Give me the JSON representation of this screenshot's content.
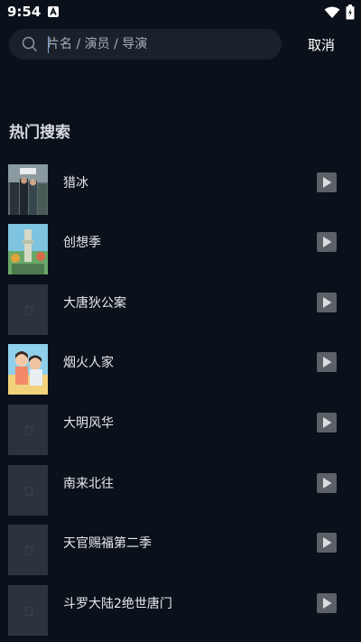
{
  "status_bar": {
    "time": "9:54"
  },
  "search": {
    "placeholder": "片名 / 演员 / 导演",
    "cancel_label": "取消"
  },
  "hot_section": {
    "title": "热门搜索"
  },
  "items": [
    {
      "title": "猎冰",
      "poster": "image"
    },
    {
      "title": "创想季",
      "poster": "image"
    },
    {
      "title": "大唐狄公案",
      "poster": "placeholder"
    },
    {
      "title": "烟火人家",
      "poster": "image"
    },
    {
      "title": "大明风华",
      "poster": "placeholder"
    },
    {
      "title": "南来北往",
      "poster": "placeholder"
    },
    {
      "title": "天官赐福第二季",
      "poster": "placeholder"
    },
    {
      "title": "斗罗大陆2绝世唐门",
      "poster": "placeholder"
    }
  ],
  "colors": {
    "background": "#0b111a",
    "search_box": "#1a212b",
    "play_button": "#5c6168"
  }
}
